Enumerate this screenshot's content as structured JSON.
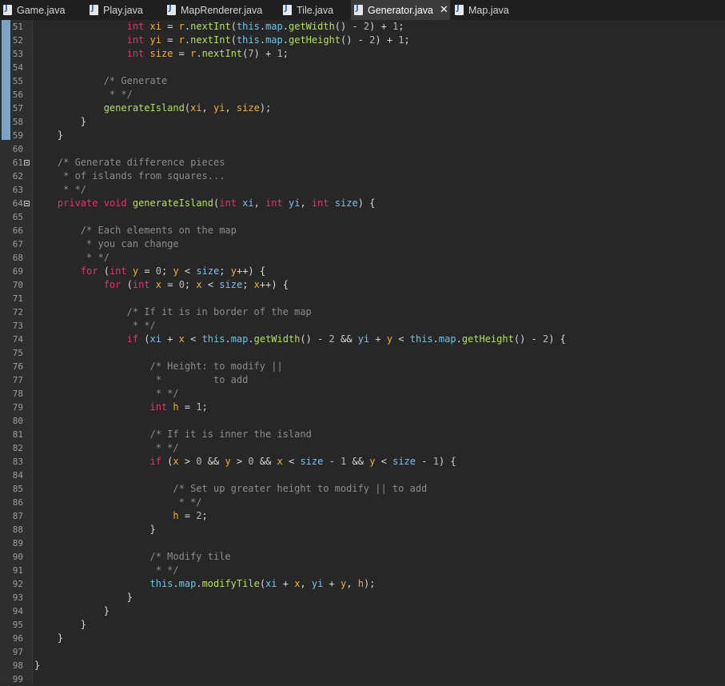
{
  "tabs": [
    {
      "label": "Game.java",
      "active": false
    },
    {
      "label": "Play.java",
      "active": false
    },
    {
      "label": "MapRenderer.java",
      "active": false
    },
    {
      "label": "Tile.java",
      "active": false
    },
    {
      "label": "Generator.java",
      "active": true,
      "close_icon": "close-icon"
    },
    {
      "label": "Map.java",
      "active": false
    }
  ],
  "file_icon": "java-file-icon",
  "colors": {
    "keyword": "#e8316f",
    "method": "#b4e05a",
    "variable": "#f2b13a",
    "parameter": "#7ec0e8",
    "field": "#6dc5e6",
    "comment": "#8c8c8c",
    "number": "#b8b8b8",
    "change_bar": "#7da2c2"
  },
  "fold_lines": [
    61,
    64
  ],
  "lines": [
    {
      "n": "51",
      "tokens": [
        [
          "o",
          "                "
        ],
        [
          "t",
          "int"
        ],
        [
          "o",
          " "
        ],
        [
          "v",
          "xi"
        ],
        [
          "o",
          " = "
        ],
        [
          "v",
          "r"
        ],
        [
          "o",
          "."
        ],
        [
          "f",
          "nextInt"
        ],
        [
          "o",
          "("
        ],
        [
          "fd",
          "this"
        ],
        [
          "o",
          "."
        ],
        [
          "fd",
          "map"
        ],
        [
          "o",
          "."
        ],
        [
          "f",
          "getWidth"
        ],
        [
          "o",
          "() - "
        ],
        [
          "n",
          "2"
        ],
        [
          "o",
          ") + "
        ],
        [
          "n",
          "1"
        ],
        [
          "o",
          ";"
        ]
      ]
    },
    {
      "n": "52",
      "tokens": [
        [
          "o",
          "                "
        ],
        [
          "t",
          "int"
        ],
        [
          "o",
          " "
        ],
        [
          "v",
          "yi"
        ],
        [
          "o",
          " = "
        ],
        [
          "v",
          "r"
        ],
        [
          "o",
          "."
        ],
        [
          "f",
          "nextInt"
        ],
        [
          "o",
          "("
        ],
        [
          "fd",
          "this"
        ],
        [
          "o",
          "."
        ],
        [
          "fd",
          "map"
        ],
        [
          "o",
          "."
        ],
        [
          "f",
          "getHeight"
        ],
        [
          "o",
          "() - "
        ],
        [
          "n",
          "2"
        ],
        [
          "o",
          ") + "
        ],
        [
          "n",
          "1"
        ],
        [
          "o",
          ";"
        ]
      ]
    },
    {
      "n": "53",
      "tokens": [
        [
          "o",
          "                "
        ],
        [
          "t",
          "int"
        ],
        [
          "o",
          " "
        ],
        [
          "v",
          "size"
        ],
        [
          "o",
          " = "
        ],
        [
          "v",
          "r"
        ],
        [
          "o",
          "."
        ],
        [
          "f",
          "nextInt"
        ],
        [
          "o",
          "("
        ],
        [
          "n",
          "7"
        ],
        [
          "o",
          ") + "
        ],
        [
          "n",
          "1"
        ],
        [
          "o",
          ";"
        ]
      ]
    },
    {
      "n": "54",
      "tokens": []
    },
    {
      "n": "55",
      "tokens": [
        [
          "o",
          "            "
        ],
        [
          "c",
          "/* Generate"
        ]
      ]
    },
    {
      "n": "56",
      "tokens": [
        [
          "o",
          "             "
        ],
        [
          "c",
          "* */"
        ]
      ]
    },
    {
      "n": "57",
      "tokens": [
        [
          "o",
          "            "
        ],
        [
          "f",
          "generateIsland"
        ],
        [
          "o",
          "("
        ],
        [
          "v",
          "xi"
        ],
        [
          "o",
          ", "
        ],
        [
          "v",
          "yi"
        ],
        [
          "o",
          ", "
        ],
        [
          "v",
          "size"
        ],
        [
          "o",
          ");"
        ]
      ]
    },
    {
      "n": "58",
      "tokens": [
        [
          "o",
          "        }"
        ]
      ]
    },
    {
      "n": "59",
      "tokens": [
        [
          "o",
          "    }"
        ]
      ]
    },
    {
      "n": "60",
      "tokens": []
    },
    {
      "n": "61",
      "tokens": [
        [
          "o",
          "    "
        ],
        [
          "c",
          "/* Generate difference pieces"
        ]
      ]
    },
    {
      "n": "62",
      "tokens": [
        [
          "o",
          "     "
        ],
        [
          "c",
          "* of islands from squares..."
        ]
      ]
    },
    {
      "n": "63",
      "tokens": [
        [
          "o",
          "     "
        ],
        [
          "c",
          "* */"
        ]
      ]
    },
    {
      "n": "64",
      "tokens": [
        [
          "o",
          "    "
        ],
        [
          "k",
          "private"
        ],
        [
          "o",
          " "
        ],
        [
          "t",
          "void"
        ],
        [
          "o",
          " "
        ],
        [
          "f",
          "generateIsland"
        ],
        [
          "o",
          "("
        ],
        [
          "t",
          "int"
        ],
        [
          "o",
          " "
        ],
        [
          "p",
          "xi"
        ],
        [
          "o",
          ", "
        ],
        [
          "t",
          "int"
        ],
        [
          "o",
          " "
        ],
        [
          "p",
          "yi"
        ],
        [
          "o",
          ", "
        ],
        [
          "t",
          "int"
        ],
        [
          "o",
          " "
        ],
        [
          "p",
          "size"
        ],
        [
          "o",
          ") {"
        ]
      ]
    },
    {
      "n": "65",
      "tokens": []
    },
    {
      "n": "66",
      "tokens": [
        [
          "o",
          "        "
        ],
        [
          "c",
          "/* Each elements on the map"
        ]
      ]
    },
    {
      "n": "67",
      "tokens": [
        [
          "o",
          "         "
        ],
        [
          "c",
          "* you can change"
        ]
      ]
    },
    {
      "n": "68",
      "tokens": [
        [
          "o",
          "         "
        ],
        [
          "c",
          "* */"
        ]
      ]
    },
    {
      "n": "69",
      "tokens": [
        [
          "o",
          "        "
        ],
        [
          "k",
          "for"
        ],
        [
          "o",
          " ("
        ],
        [
          "t",
          "int"
        ],
        [
          "o",
          " "
        ],
        [
          "v",
          "y"
        ],
        [
          "o",
          " = "
        ],
        [
          "n",
          "0"
        ],
        [
          "o",
          "; "
        ],
        [
          "v",
          "y"
        ],
        [
          "o",
          " < "
        ],
        [
          "p",
          "size"
        ],
        [
          "o",
          "; "
        ],
        [
          "v",
          "y"
        ],
        [
          "o",
          "++) {"
        ]
      ]
    },
    {
      "n": "70",
      "tokens": [
        [
          "o",
          "            "
        ],
        [
          "k",
          "for"
        ],
        [
          "o",
          " ("
        ],
        [
          "t",
          "int"
        ],
        [
          "o",
          " "
        ],
        [
          "v",
          "x"
        ],
        [
          "o",
          " = "
        ],
        [
          "n",
          "0"
        ],
        [
          "o",
          "; "
        ],
        [
          "v",
          "x"
        ],
        [
          "o",
          " < "
        ],
        [
          "p",
          "size"
        ],
        [
          "o",
          "; "
        ],
        [
          "v",
          "x"
        ],
        [
          "o",
          "++) {"
        ]
      ]
    },
    {
      "n": "71",
      "tokens": []
    },
    {
      "n": "72",
      "tokens": [
        [
          "o",
          "                "
        ],
        [
          "c",
          "/* If it is in border of the map"
        ]
      ]
    },
    {
      "n": "73",
      "tokens": [
        [
          "o",
          "                 "
        ],
        [
          "c",
          "* */"
        ]
      ]
    },
    {
      "n": "74",
      "tokens": [
        [
          "o",
          "                "
        ],
        [
          "k",
          "if"
        ],
        [
          "o",
          " ("
        ],
        [
          "p",
          "xi"
        ],
        [
          "o",
          " + "
        ],
        [
          "v",
          "x"
        ],
        [
          "o",
          " < "
        ],
        [
          "fd",
          "this"
        ],
        [
          "o",
          "."
        ],
        [
          "fd",
          "map"
        ],
        [
          "o",
          "."
        ],
        [
          "f",
          "getWidth"
        ],
        [
          "o",
          "() - "
        ],
        [
          "n",
          "2"
        ],
        [
          "o",
          " && "
        ],
        [
          "p",
          "yi"
        ],
        [
          "o",
          " + "
        ],
        [
          "v",
          "y"
        ],
        [
          "o",
          " < "
        ],
        [
          "fd",
          "this"
        ],
        [
          "o",
          "."
        ],
        [
          "fd",
          "map"
        ],
        [
          "o",
          "."
        ],
        [
          "f",
          "getHeight"
        ],
        [
          "o",
          "() - "
        ],
        [
          "n",
          "2"
        ],
        [
          "o",
          ") {"
        ]
      ]
    },
    {
      "n": "75",
      "tokens": []
    },
    {
      "n": "76",
      "tokens": [
        [
          "o",
          "                    "
        ],
        [
          "c",
          "/* Height: to modify ||"
        ]
      ]
    },
    {
      "n": "77",
      "tokens": [
        [
          "o",
          "                     "
        ],
        [
          "c",
          "*         to add"
        ]
      ]
    },
    {
      "n": "78",
      "tokens": [
        [
          "o",
          "                     "
        ],
        [
          "c",
          "* */"
        ]
      ]
    },
    {
      "n": "79",
      "tokens": [
        [
          "o",
          "                    "
        ],
        [
          "t",
          "int"
        ],
        [
          "o",
          " "
        ],
        [
          "v",
          "h"
        ],
        [
          "o",
          " = "
        ],
        [
          "n",
          "1"
        ],
        [
          "o",
          ";"
        ]
      ]
    },
    {
      "n": "80",
      "tokens": []
    },
    {
      "n": "81",
      "tokens": [
        [
          "o",
          "                    "
        ],
        [
          "c",
          "/* If it is inner the island"
        ]
      ]
    },
    {
      "n": "82",
      "tokens": [
        [
          "o",
          "                     "
        ],
        [
          "c",
          "* */"
        ]
      ]
    },
    {
      "n": "83",
      "tokens": [
        [
          "o",
          "                    "
        ],
        [
          "k",
          "if"
        ],
        [
          "o",
          " ("
        ],
        [
          "v",
          "x"
        ],
        [
          "o",
          " > "
        ],
        [
          "n",
          "0"
        ],
        [
          "o",
          " && "
        ],
        [
          "v",
          "y"
        ],
        [
          "o",
          " > "
        ],
        [
          "n",
          "0"
        ],
        [
          "o",
          " && "
        ],
        [
          "v",
          "x"
        ],
        [
          "o",
          " < "
        ],
        [
          "p",
          "size"
        ],
        [
          "o",
          " - "
        ],
        [
          "n",
          "1"
        ],
        [
          "o",
          " && "
        ],
        [
          "v",
          "y"
        ],
        [
          "o",
          " < "
        ],
        [
          "p",
          "size"
        ],
        [
          "o",
          " - "
        ],
        [
          "n",
          "1"
        ],
        [
          "o",
          ") {"
        ]
      ]
    },
    {
      "n": "84",
      "tokens": []
    },
    {
      "n": "85",
      "tokens": [
        [
          "o",
          "                        "
        ],
        [
          "c",
          "/* Set up greater height to modify || to add"
        ]
      ]
    },
    {
      "n": "86",
      "tokens": [
        [
          "o",
          "                         "
        ],
        [
          "c",
          "* */"
        ]
      ]
    },
    {
      "n": "87",
      "tokens": [
        [
          "o",
          "                        "
        ],
        [
          "v",
          "h"
        ],
        [
          "o",
          " = "
        ],
        [
          "n",
          "2"
        ],
        [
          "o",
          ";"
        ]
      ]
    },
    {
      "n": "88",
      "tokens": [
        [
          "o",
          "                    }"
        ]
      ]
    },
    {
      "n": "89",
      "tokens": []
    },
    {
      "n": "90",
      "tokens": [
        [
          "o",
          "                    "
        ],
        [
          "c",
          "/* Modify tile"
        ]
      ]
    },
    {
      "n": "91",
      "tokens": [
        [
          "o",
          "                     "
        ],
        [
          "c",
          "* */"
        ]
      ]
    },
    {
      "n": "92",
      "tokens": [
        [
          "o",
          "                    "
        ],
        [
          "fd",
          "this"
        ],
        [
          "o",
          "."
        ],
        [
          "fd",
          "map"
        ],
        [
          "o",
          "."
        ],
        [
          "f",
          "modifyTile"
        ],
        [
          "o",
          "("
        ],
        [
          "p",
          "xi"
        ],
        [
          "o",
          " + "
        ],
        [
          "v",
          "x"
        ],
        [
          "o",
          ", "
        ],
        [
          "p",
          "yi"
        ],
        [
          "o",
          " + "
        ],
        [
          "v",
          "y"
        ],
        [
          "o",
          ", "
        ],
        [
          "v",
          "h"
        ],
        [
          "o",
          ");"
        ]
      ]
    },
    {
      "n": "93",
      "tokens": [
        [
          "o",
          "                }"
        ]
      ]
    },
    {
      "n": "94",
      "tokens": [
        [
          "o",
          "            }"
        ]
      ]
    },
    {
      "n": "95",
      "tokens": [
        [
          "o",
          "        }"
        ]
      ]
    },
    {
      "n": "96",
      "tokens": [
        [
          "o",
          "    }"
        ]
      ]
    },
    {
      "n": "97",
      "tokens": []
    },
    {
      "n": "98",
      "tokens": [
        [
          "o",
          "}"
        ]
      ]
    },
    {
      "n": "99",
      "tokens": []
    }
  ]
}
